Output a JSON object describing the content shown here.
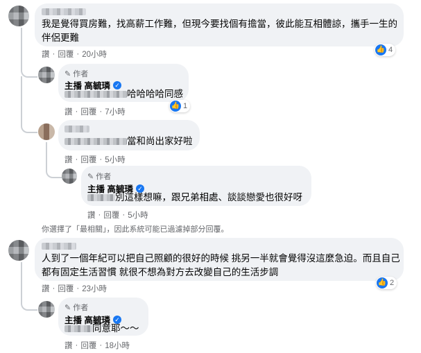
{
  "comments": [
    {
      "text": "我是覺得買房難，找高薪工作難，但現今要找個有擔當，彼此能互相體諒，攜手一生的伴侶更難",
      "actions": {
        "like": "讚",
        "reply": "回覆",
        "time": "20小時"
      },
      "reaction_count": "4",
      "replies": [
        {
          "author_badge": "作者",
          "author_name": "主播 高毓璘",
          "text": "哈哈哈哈同感",
          "actions": {
            "like": "讚",
            "reply": "回覆",
            "time": "7小時"
          },
          "reaction_count": "1"
        }
      ]
    },
    {
      "text": "當和尚出家好啦",
      "actions": {
        "like": "讚",
        "reply": "回覆",
        "time": "5小時"
      },
      "replies": [
        {
          "author_badge": "作者",
          "author_name": "主播 高毓璘",
          "text": "別這樣想嘛，跟兄弟相處、談談戀愛也很好呀",
          "actions": {
            "like": "讚",
            "reply": "回覆",
            "time": "5小時"
          }
        }
      ]
    },
    {
      "text": "人到了一個年紀可以把自己照顧的很好的時候 挑另一半就會覺得沒這麼急迫。而且自己都有固定生活習慣 就很不想為對方去改變自己的生活步調",
      "actions": {
        "like": "讚",
        "reply": "回覆",
        "time": "23小時"
      },
      "reaction_count": "2",
      "replies": [
        {
          "author_badge": "作者",
          "author_name": "主播 高毓璘",
          "text": "同意耶～～",
          "actions": {
            "like": "讚",
            "reply": "回覆",
            "time": "18小時"
          }
        }
      ]
    }
  ],
  "filter_notice": "你選擇了「最相關」，因此系統可能已過濾掉部分回覆。",
  "icons": {
    "like": "thumbs-up-icon",
    "verified": "verified-badge-icon",
    "author": "pencil-icon"
  },
  "colors": {
    "bubble": "#f0f2f5",
    "meta": "#65676b",
    "like": "#1877f2"
  }
}
